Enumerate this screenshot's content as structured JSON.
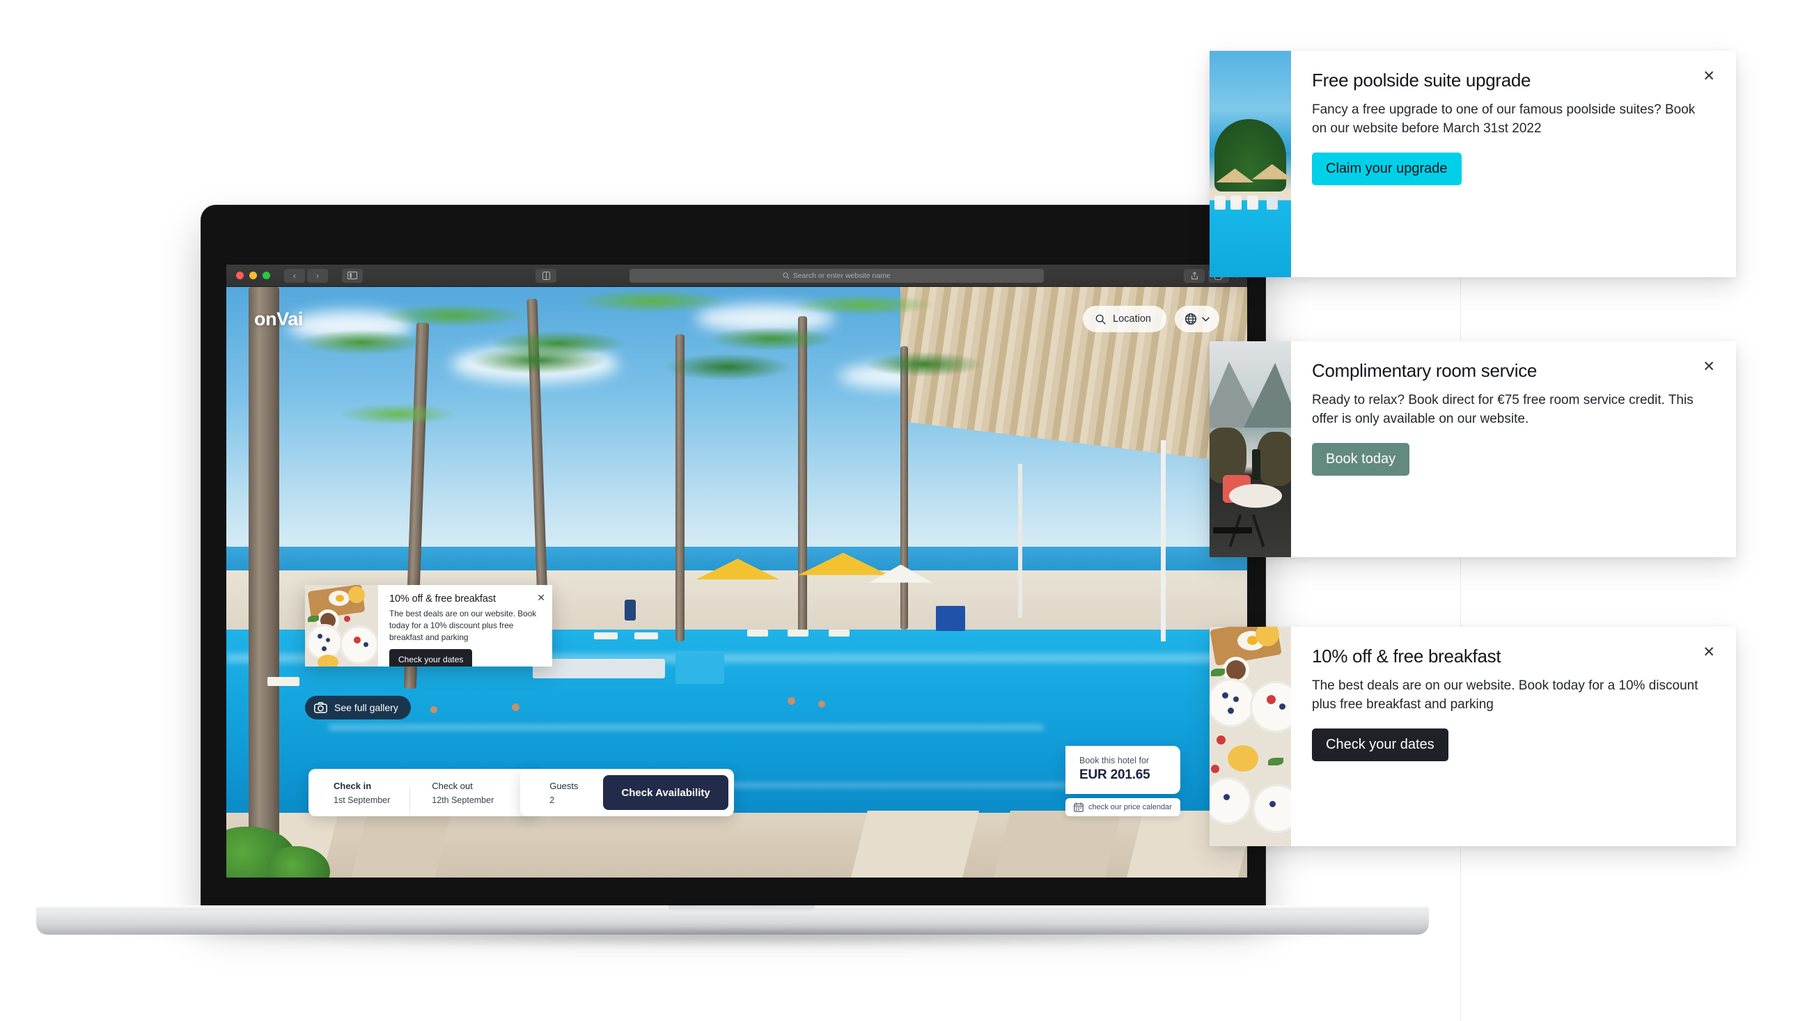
{
  "browser": {
    "url_placeholder": "Search or enter website name",
    "search_icon": "search-icon",
    "back_icon": "chevron-left-icon",
    "forward_icon": "chevron-right-icon",
    "sidebar_icon": "sidebar-icon",
    "reader_icon": "reader-view-icon",
    "share_icon": "share-icon",
    "tabs_icon": "tab-overview-icon",
    "new_tab_icon": "plus-icon",
    "traffic_lights": [
      "close",
      "minimize",
      "zoom"
    ]
  },
  "site": {
    "logo": "onVai",
    "header": {
      "location_label": "Location",
      "location_icon": "search-icon",
      "language_icon": "globe-icon",
      "language_chevron": "chevron-down-icon"
    },
    "gallery_button": {
      "label": "See full gallery",
      "icon": "camera-icon"
    },
    "booking": {
      "checkin_label": "Check in",
      "checkin_value": "1st  September",
      "checkout_label": "Check out",
      "checkout_value": "12th September",
      "guests_label": "Guests",
      "guests_value": "2",
      "cta_label": "Check Availability",
      "cta_color": "#222b49"
    },
    "price": {
      "caption": "Book this hotel for",
      "value": "EUR 201.65",
      "calendar_link": "check our price calendar",
      "calendar_icon": "calendar-icon"
    },
    "inpage_promo": {
      "title": "10% off & free breakfast",
      "text": "The best deals are on our website. Book today for a 10% discount plus free breakfast and parking",
      "cta_label": "Check your dates",
      "cta_color": "#1e2127",
      "close_icon": "close-icon",
      "thumb": "breakfast-photo"
    }
  },
  "popups": [
    {
      "title": "Free poolside suite upgrade",
      "text": "Fancy a free upgrade to one of our famous poolside suites? Book on our website before March 31st 2022",
      "cta_label": "Claim your upgrade",
      "cta_bg": "#00d0e8",
      "cta_color": "#0d1117",
      "close_icon": "close-icon",
      "thumb": "poolside-photo"
    },
    {
      "title": "Complimentary room service",
      "text": "Ready to relax? Book direct for €75 free room service credit. This offer is only available on our website.",
      "cta_label": "Book today",
      "cta_bg": "#628a7f",
      "cta_color": "#ffffff",
      "close_icon": "close-icon",
      "thumb": "lake-terrace-photo"
    },
    {
      "title": "10% off & free breakfast",
      "text": "The best deals are on our website. Book today for a 10% discount plus free breakfast and parking",
      "cta_label": "Check your dates",
      "cta_bg": "#1e2127",
      "cta_color": "#ffffff",
      "close_icon": "close-icon",
      "thumb": "breakfast-photo"
    }
  ]
}
